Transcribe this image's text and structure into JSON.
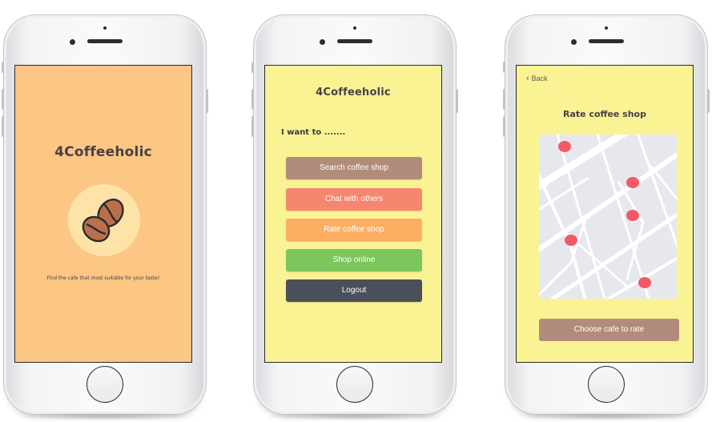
{
  "screen1": {
    "brand": "4Coffeeholic",
    "icon": "coffee-beans-icon",
    "tagline": "Find the cafe that most suitable for your taste!",
    "background": "#fcc684"
  },
  "screen2": {
    "brand": "4Coffeeholic",
    "prompt": "I want to .......",
    "background": "#f9f394",
    "buttons": [
      {
        "label": "Search coffee shop",
        "color": "#b28c7b"
      },
      {
        "label": "Chat with others",
        "color": "#f5866f"
      },
      {
        "label": "Rate coffee shop",
        "color": "#fcae62"
      },
      {
        "label": "Shop online",
        "color": "#7cc65c"
      },
      {
        "label": "Logout",
        "color": "#4b4f59"
      }
    ]
  },
  "screen3": {
    "back_label": "Back",
    "title": "Rate coffee shop",
    "map_icon": "map-icon",
    "pin_color": "#f15a66",
    "button_label": "Choose cafe to rate",
    "background": "#f9f394"
  }
}
